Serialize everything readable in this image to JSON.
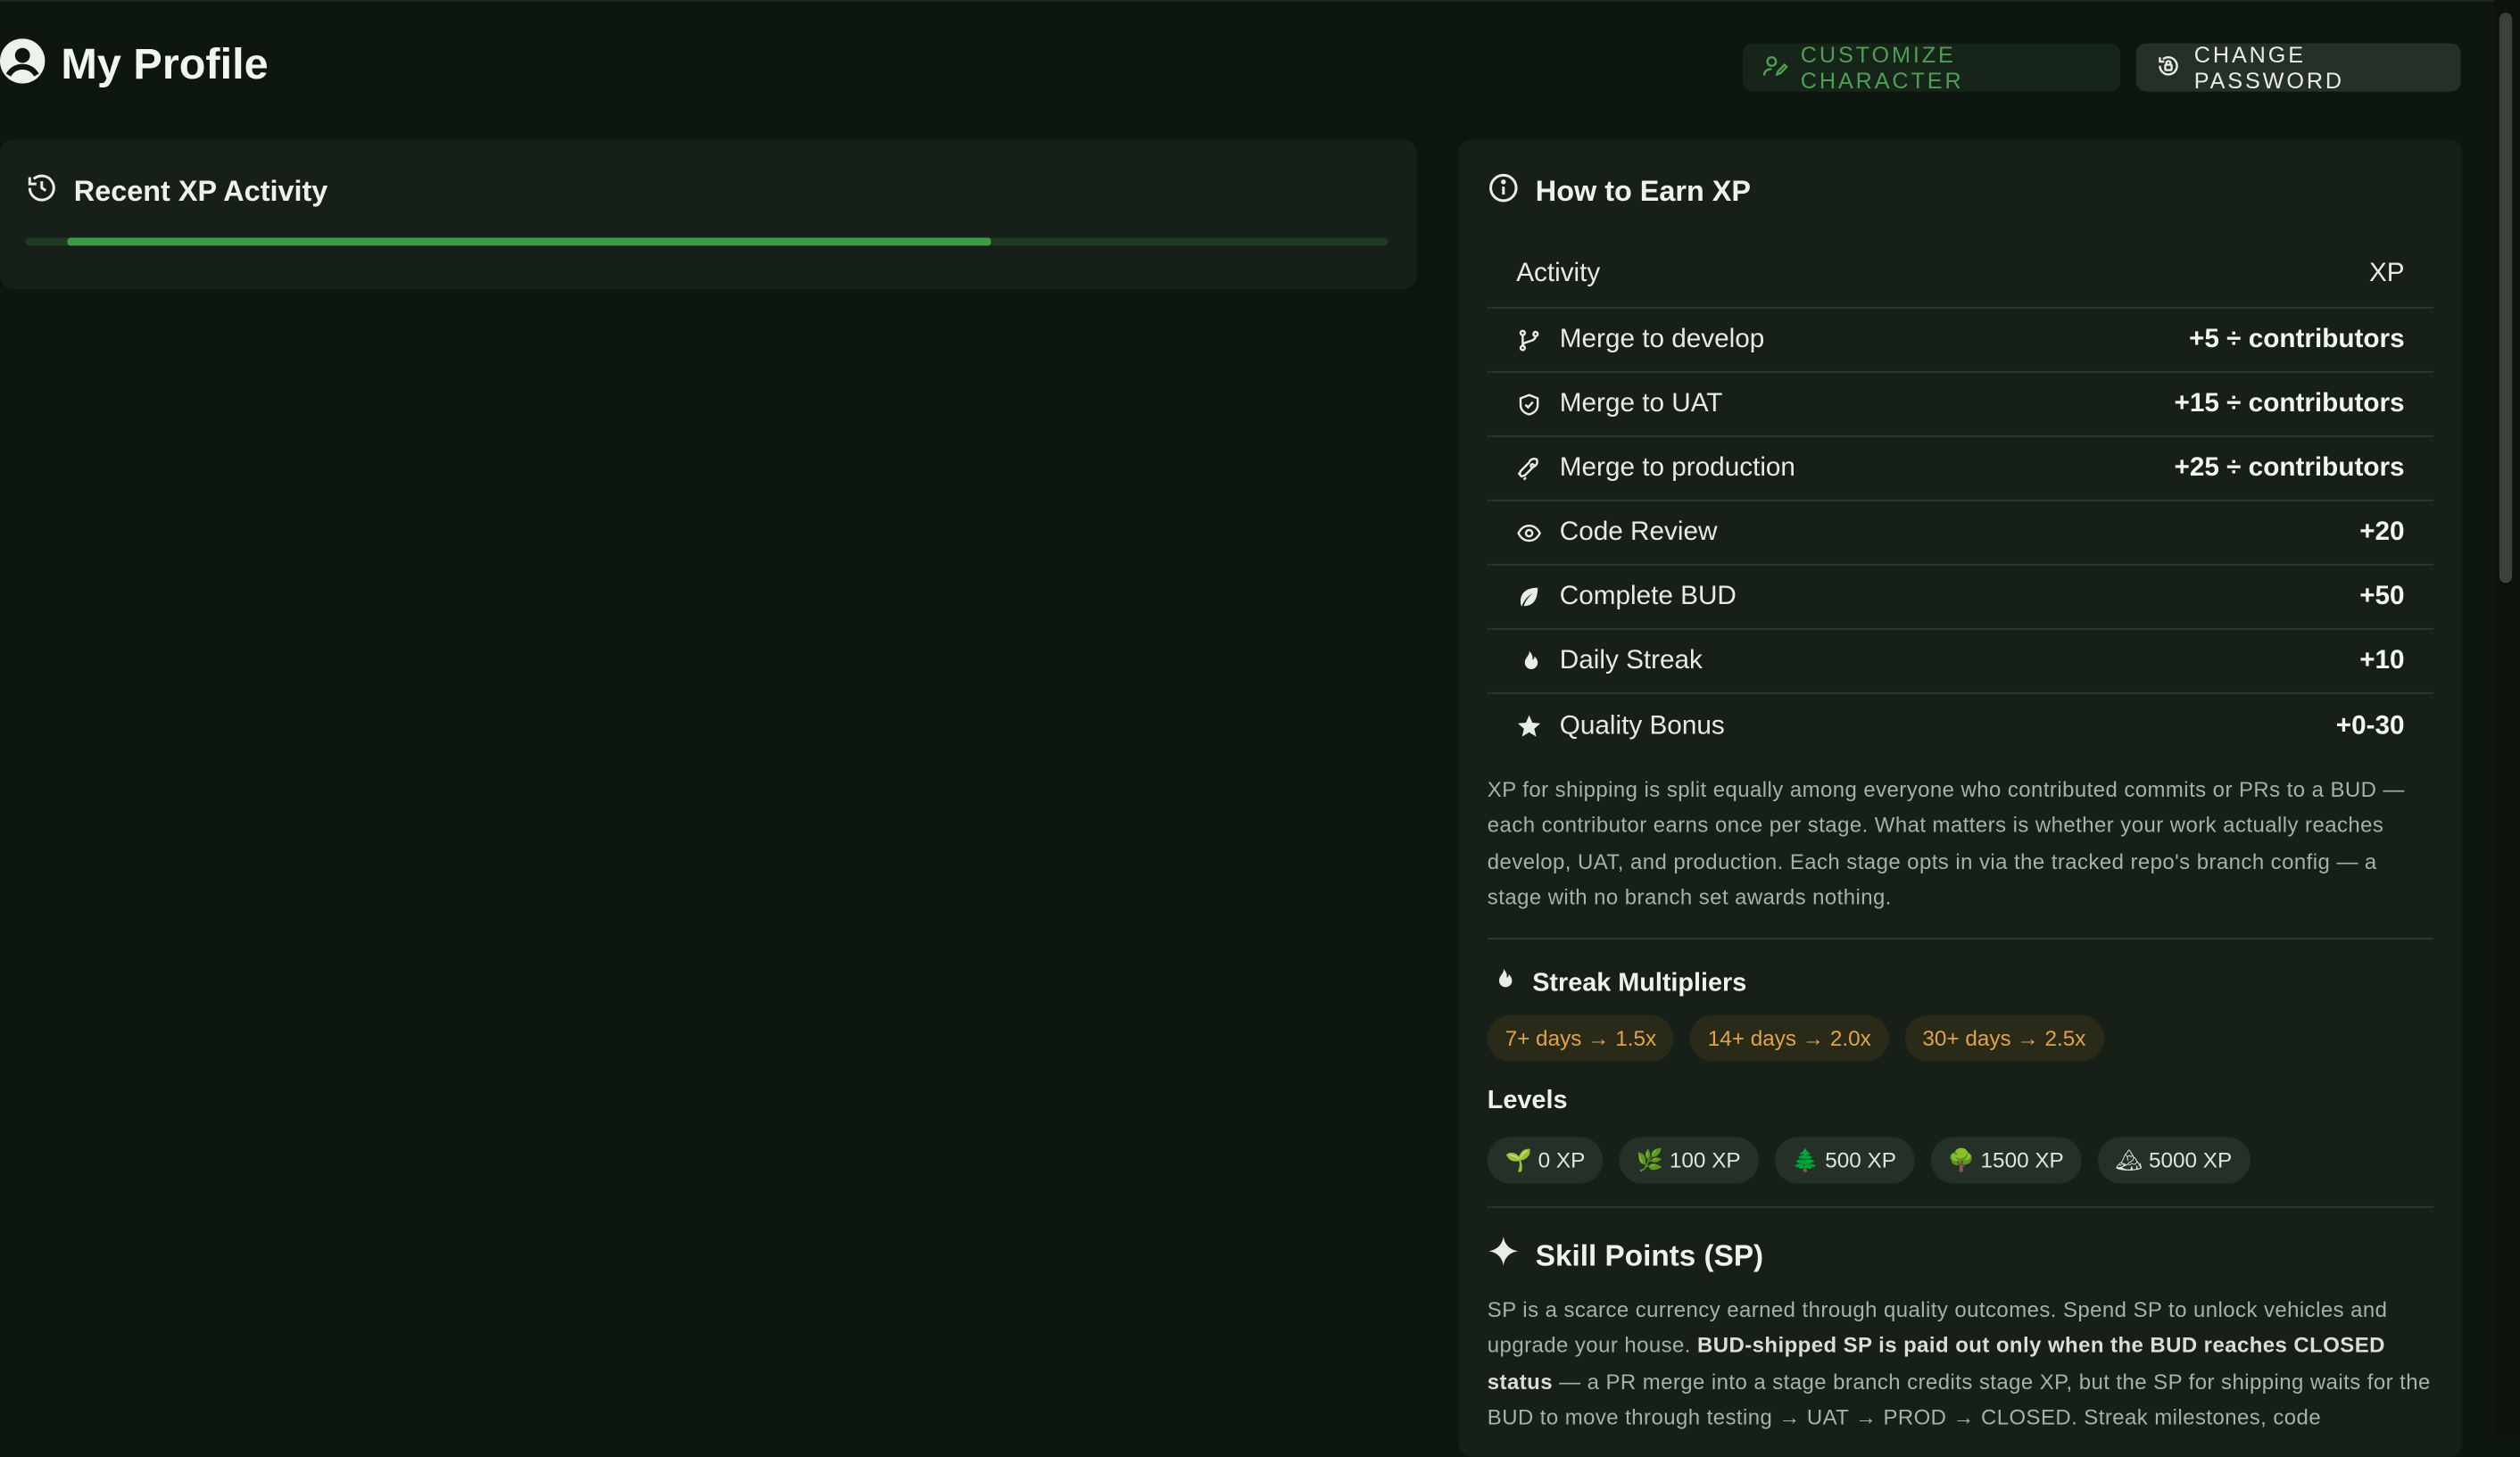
{
  "header": {
    "title": "My Profile",
    "customize_label": "CUSTOMIZE CHARACTER",
    "password_label": "CHANGE PASSWORD"
  },
  "activity": {
    "title": "Recent XP Activity",
    "progress": 0.7
  },
  "earn": {
    "title": "How to Earn XP",
    "columns": {
      "activity": "Activity",
      "xp": "XP"
    },
    "rows": [
      {
        "icon": "git-branch-icon",
        "name": "Merge to develop",
        "xp": "+5 ÷ contributors"
      },
      {
        "icon": "shield-check-icon",
        "name": "Merge to UAT",
        "xp": "+15 ÷ contributors"
      },
      {
        "icon": "rocket-icon",
        "name": "Merge to production",
        "xp": "+25 ÷ contributors"
      },
      {
        "icon": "eye-icon",
        "name": "Code Review",
        "xp": "+20"
      },
      {
        "icon": "leaf-icon",
        "name": "Complete BUD",
        "xp": "+50"
      },
      {
        "icon": "flame-icon",
        "name": "Daily Streak",
        "xp": "+10"
      },
      {
        "icon": "star-icon",
        "name": "Quality Bonus",
        "xp": "+0-30"
      }
    ],
    "note": "XP for shipping is split equally among everyone who contributed commits or PRs to a BUD — each contributor earns once per stage. What matters is whether your work actually reaches develop, UAT, and production. Each stage opts in via the tracked repo's branch config — a stage with no branch set awards nothing.",
    "streak_title": "Streak Multipliers",
    "streaks": [
      "7+ days → 1.5x",
      "14+ days → 2.0x",
      "30+ days → 2.5x"
    ],
    "levels_title": "Levels",
    "levels": [
      "🌱 0 XP",
      "🌿 100 XP",
      "🌲 500 XP",
      "🌳 1500 XP",
      "🏔 5000 XP"
    ],
    "sp_title": "Skill Points (SP)",
    "sp_text_1": "SP is a scarce currency earned through quality outcomes. Spend SP to unlock vehicles and upgrade your house. ",
    "sp_text_bold": "BUD-shipped SP is paid out only when the BUD reaches CLOSED status",
    "sp_text_2": " — a PR merge into a stage branch credits stage XP, but the SP for shipping waits for the BUD to move through testing → UAT → PROD → CLOSED. Streak milestones, code"
  },
  "colors": {
    "background": "#0e170f",
    "card": "#162018",
    "accent_green": "#3c9a44",
    "streak_orange": "#e3a14a"
  }
}
